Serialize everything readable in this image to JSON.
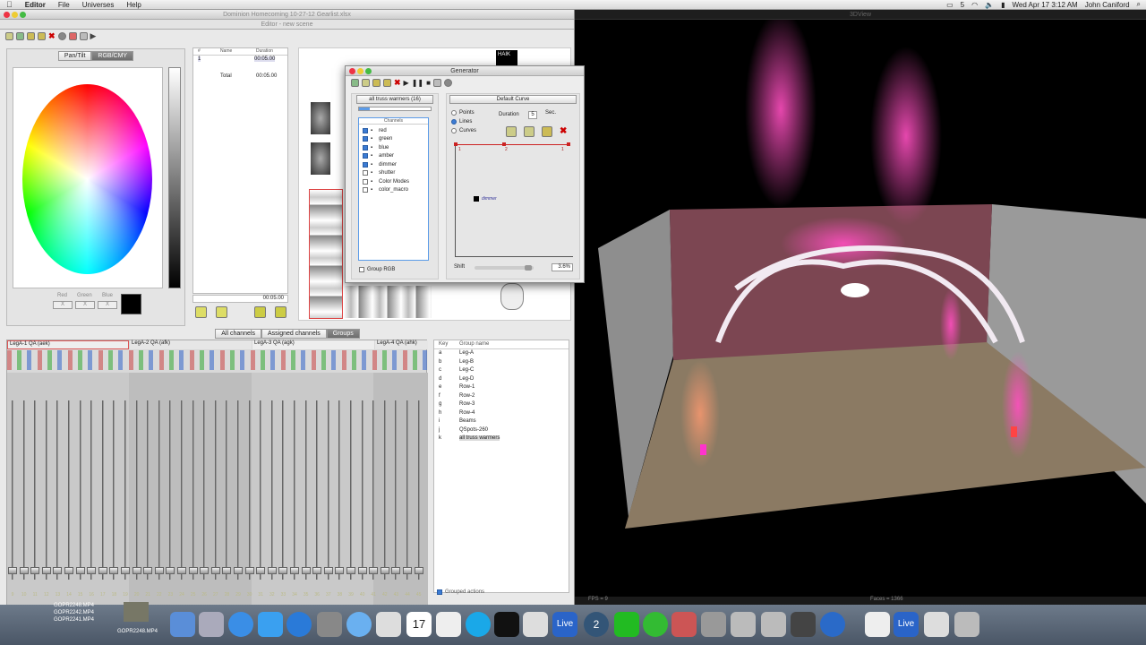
{
  "menubar": {
    "app": "Editor",
    "items": [
      "File",
      "Universes",
      "Help"
    ],
    "clock": "Wed Apr 17  3:12 AM",
    "user": "John Caniford",
    "badge": "5"
  },
  "editor": {
    "title": "Dominion Homecoming 10-27-12 Gearlist.xlsx",
    "subtitle": "Editor - new scene",
    "color_tabs": [
      "Pan/Tilt",
      "RGB/CMY"
    ],
    "rgb": {
      "red_label": "Red",
      "green_label": "Green",
      "blue_label": "Blue",
      "red": "X",
      "green": "X",
      "blue": "X"
    },
    "steps": {
      "headers": [
        "#",
        "Name",
        "Duration"
      ],
      "row_num": "1",
      "row_dur": "00:05.00",
      "total_label": "Total",
      "total": "00:05.00",
      "footer": "00:05.00"
    },
    "haik": "HAIK",
    "channel_tabs": [
      "All channels",
      "Assigned channels",
      "Groups"
    ],
    "fixtures": [
      "LegA-1 QA (aek)",
      "LegA-2 QA (afk)",
      "LegA-3 QA (agk)",
      "LegA-4 QA (ahk)"
    ],
    "groups": {
      "headers": [
        "Key",
        "Group name"
      ],
      "rows": [
        [
          "a",
          "Leg-A"
        ],
        [
          "b",
          "Leg-B"
        ],
        [
          "c",
          "Leg-C"
        ],
        [
          "d",
          "Leg-D"
        ],
        [
          "e",
          "Row-1"
        ],
        [
          "f",
          "Row-2"
        ],
        [
          "g",
          "Row-3"
        ],
        [
          "h",
          "Row-4"
        ],
        [
          "i",
          "Beams"
        ],
        [
          "j",
          "QSpots-260"
        ],
        [
          "k",
          "all truss warmers"
        ]
      ],
      "grouped_actions": "Grouped actions"
    },
    "fader_numbers": [
      "9",
      "10",
      "11",
      "12",
      "13",
      "14",
      "15",
      "16",
      "17",
      "18",
      "19",
      "20",
      "21",
      "22",
      "23",
      "24",
      "25",
      "26",
      "27",
      "28",
      "29",
      "30",
      "31",
      "32",
      "33",
      "34",
      "35",
      "36",
      "37",
      "38",
      "39",
      "40",
      "41",
      "42",
      "43",
      "44",
      "45"
    ]
  },
  "generator": {
    "title": "Generator",
    "group": "all truss warmers (16)",
    "channels_header": "Channels",
    "channels": [
      {
        "name": "red",
        "on": true
      },
      {
        "name": "green",
        "on": true
      },
      {
        "name": "blue",
        "on": true
      },
      {
        "name": "amber",
        "on": true
      },
      {
        "name": "dimmer",
        "on": true
      },
      {
        "name": "shutter",
        "on": false
      },
      {
        "name": "Color Modes",
        "on": false
      },
      {
        "name": "color_macro",
        "on": false
      }
    ],
    "group_rgb": "Group RGB",
    "curve": "Default Curve",
    "modes": [
      "Points",
      "Lines",
      "Curves"
    ],
    "duration_label": "Duration",
    "duration": "5",
    "sec": "Sec.",
    "points": [
      "1",
      "2",
      "1"
    ],
    "legend": "dimmer",
    "shift_label": "Shift",
    "shift": "3.6%"
  },
  "viewer": {
    "title": "3DView",
    "fps": "FPS = 9",
    "faces": "Faces = 1366"
  },
  "dock": {
    "files": [
      "GOPR2248.MP4",
      "GOPR2242.MP4",
      "GOPR2241.MP4",
      "GOPR2248.MP4"
    ],
    "live": "Live",
    "calendar": "17",
    "two": "2"
  }
}
